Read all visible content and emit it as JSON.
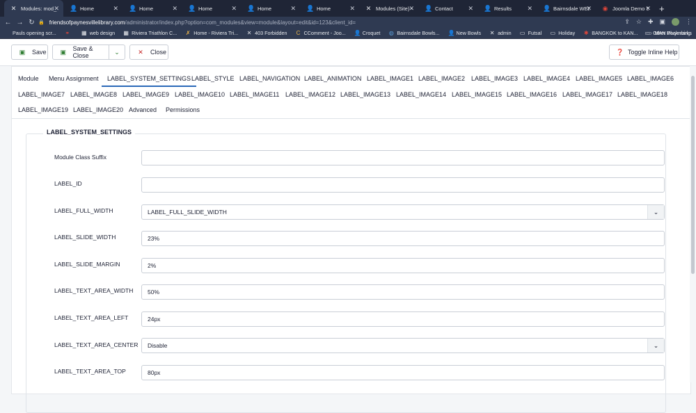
{
  "browser": {
    "tabs": [
      {
        "title": "Modules: mod_",
        "active": true
      },
      {
        "title": "Home"
      },
      {
        "title": "Home"
      },
      {
        "title": "Home"
      },
      {
        "title": "Home"
      },
      {
        "title": "Home"
      },
      {
        "title": "Modules (Site) - "
      },
      {
        "title": "Contact"
      },
      {
        "title": "Results"
      },
      {
        "title": "Bairnsdale WEB"
      },
      {
        "title": "Joomla Demo Sit"
      }
    ],
    "new_tab": "+",
    "url_host": "friendsofpaynesvillelibrary.com",
    "url_path": "/administrator/index.php?option=com_modules&view=module&layout=edit&id=123&client_id=",
    "bookmarks": [
      "Pauls opening scr...",
      "",
      "web design",
      "Riviera Triathlon C...",
      "Home - Riviera Tri...",
      "403 Forbidden",
      "CComment - Joo...",
      "Croquet",
      "Bairnsdale Bowls...",
      "New Bowls",
      "admin",
      "Futsal",
      "Holiday",
      "BANGKOK to KAN...",
      "MAN Pluymbing"
    ],
    "other_bookmarks": "Other Bookmarks"
  },
  "toolbar": {
    "save": "Save",
    "save_close": "Save & Close",
    "close": "Close",
    "help": "Toggle Inline Help"
  },
  "tabs": [
    "Module",
    "Menu Assignment",
    "LABEL_SYSTEM_SETTINGS",
    "LABEL_STYLE",
    "LABEL_NAVIGATION",
    "LABEL_ANIMATION",
    "LABEL_IMAGE1",
    "LABEL_IMAGE2",
    "LABEL_IMAGE3",
    "LABEL_IMAGE4",
    "LABEL_IMAGE5",
    "LABEL_IMAGE6",
    "LABEL_IMAGE7",
    "LABEL_IMAGE8",
    "LABEL_IMAGE9",
    "LABEL_IMAGE10",
    "LABEL_IMAGE11",
    "LABEL_IMAGE12",
    "LABEL_IMAGE13",
    "LABEL_IMAGE14",
    "LABEL_IMAGE15",
    "LABEL_IMAGE16",
    "LABEL_IMAGE17",
    "LABEL_IMAGE18",
    "LABEL_IMAGE19",
    "LABEL_IMAGE20",
    "Advanced",
    "Permissions"
  ],
  "active_tab": "LABEL_SYSTEM_SETTINGS",
  "fieldset": {
    "legend": "LABEL_SYSTEM_SETTINGS",
    "fields": [
      {
        "label": "Module Class Suffix",
        "value": "",
        "type": "text"
      },
      {
        "label": "LABEL_ID",
        "value": "",
        "type": "text"
      },
      {
        "label": "LABEL_FULL_WIDTH",
        "value": "LABEL_FULL_SLIDE_WIDTH",
        "type": "select"
      },
      {
        "label": "LABEL_SLIDE_WIDTH",
        "value": "23%",
        "type": "text"
      },
      {
        "label": "LABEL_SLIDE_MARGIN",
        "value": "2%",
        "type": "text"
      },
      {
        "label": "LABEL_TEXT_AREA_WIDTH",
        "value": "50%",
        "type": "text"
      },
      {
        "label": "LABEL_TEXT_AREA_LEFT",
        "value": "24px",
        "type": "text"
      },
      {
        "label": "LABEL_TEXT_AREA_CENTER",
        "value": "Disable",
        "type": "select"
      },
      {
        "label": "LABEL_TEXT_AREA_TOP",
        "value": "80px",
        "type": "text"
      }
    ]
  },
  "colors": {
    "accent": "#2a69b8",
    "chrome_dark": "#1f2536",
    "chrome_bar": "#2f3a52",
    "save_green": "#2f7d32",
    "close_red": "#c52827"
  }
}
